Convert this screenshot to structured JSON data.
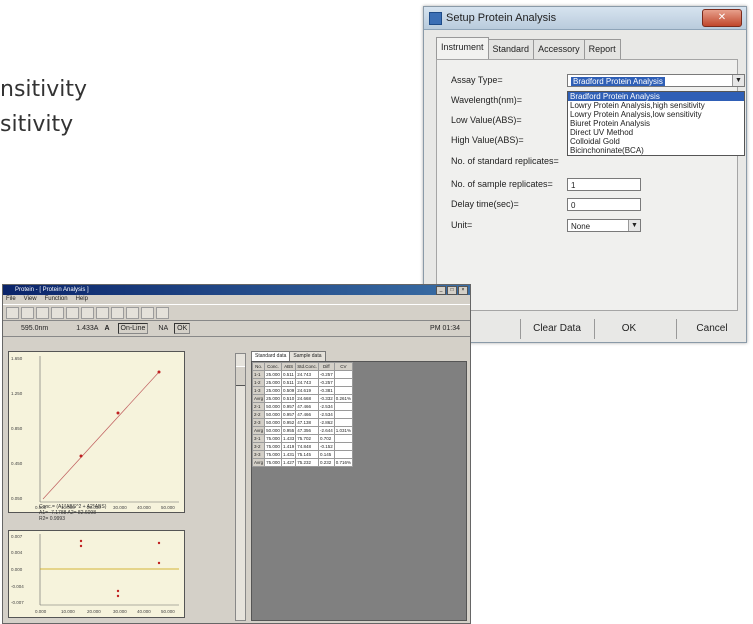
{
  "background": {
    "line1": "nsitivity",
    "line2": "sitivity"
  },
  "dialog": {
    "title": "Setup Protein Analysis",
    "tabs": [
      "Instrument",
      "Standard",
      "Accessory",
      "Report"
    ],
    "labels": {
      "assay_type": "Assay Type=",
      "wavelength": "Wavelength(nm)=",
      "low_value": "Low Value(ABS)=",
      "high_value": "High Value(ABS)=",
      "std_reps": "No. of standard replicates=",
      "sample_reps": "No. of sample replicates=",
      "delay": "Delay time(sec)=",
      "unit": "Unit="
    },
    "assay_selected": "Bradford Protein Analysis",
    "assay_options": [
      "Bradford Protein Analysis",
      "Lowry Protein Analysis,high sensitivity",
      "Lowry Protein Analysis,low sensitivity",
      "Biuret Protein Analysis",
      "Direct UV Method",
      "Colloidal Gold",
      "Bicinchoninate(BCA)"
    ],
    "sample_reps_value": "1",
    "delay_value": "0",
    "unit_value": "None",
    "buttons": {
      "clear": "Clear Data",
      "ok": "OK",
      "cancel": "Cancel"
    }
  },
  "app": {
    "title": "Protein - [ Protein Analysis ]",
    "menu": [
      "File",
      "View",
      "Function",
      "Help"
    ],
    "status": {
      "wavelength": "595.0nm",
      "abs": "1.433A",
      "mode": "On-Line",
      "na": "NA",
      "ok": "OK",
      "time": "PM 01:34"
    },
    "result_tabs": [
      "Standard data",
      "Sample data"
    ],
    "equation_lines": [
      "Conc.= (A1*ABS^2 + A2*ABS)",
      "A1= -7.1788   A2= 82.6098",
      "R2= 0.9993"
    ],
    "plot1_yticks": [
      "1.650",
      "1.250",
      "0.850",
      "0.450",
      "0.050"
    ],
    "plot1_xticks": [
      "0.000",
      "10.000",
      "20.000",
      "30.000",
      "40.000",
      "50.000"
    ],
    "plot2_yticks": [
      "0.007",
      "0.004",
      "0.000",
      "-0.004",
      "-0.007"
    ],
    "table": {
      "headers": [
        "No.",
        "Conc.",
        "ABS",
        "Std.Conc.",
        "Diff",
        "CV"
      ],
      "rows": [
        [
          "1-1",
          "25.000",
          "0.511",
          "24.743",
          "-0.257",
          ""
        ],
        [
          "1-2",
          "25.000",
          "0.511",
          "24.743",
          "-0.257",
          ""
        ],
        [
          "1-3",
          "25.000",
          "0.509",
          "24.619",
          "-0.381",
          ""
        ],
        [
          "Avrg",
          "25.000",
          "0.510",
          "24.668",
          "-0.332",
          "0.261%"
        ],
        [
          "2-1",
          "50.000",
          "0.957",
          "47.466",
          "-2.534",
          ""
        ],
        [
          "2-2",
          "50.000",
          "0.957",
          "47.466",
          "-2.534",
          ""
        ],
        [
          "2-3",
          "50.000",
          "0.952",
          "47.138",
          "-2.862",
          ""
        ],
        [
          "Avrg",
          "50.000",
          "0.955",
          "47.356",
          "-2.644",
          "1.031%"
        ],
        [
          "3-1",
          "75.000",
          "1.433",
          "75.702",
          "0.702",
          ""
        ],
        [
          "3-2",
          "75.000",
          "1.419",
          "74.848",
          "-0.152",
          ""
        ],
        [
          "3-3",
          "75.000",
          "1.431",
          "75.145",
          "0.145",
          ""
        ],
        [
          "Avrg",
          "75.000",
          "1.427",
          "75.232",
          "0.232",
          "0.716%"
        ]
      ]
    }
  }
}
